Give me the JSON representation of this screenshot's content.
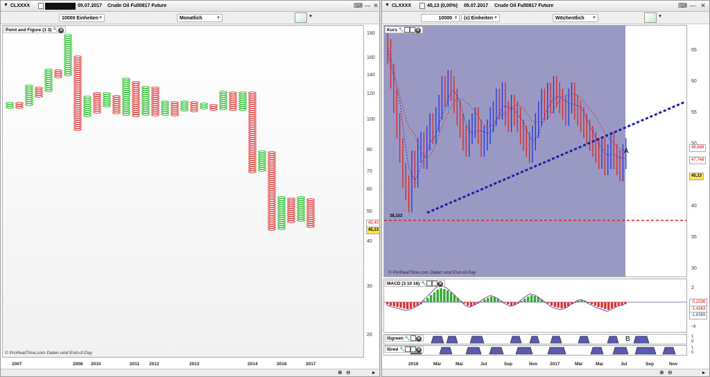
{
  "left": {
    "header": {
      "symbol": "CLXXXX",
      "redacted": "",
      "date": "05.07.2017",
      "name": "Crude Oil Full0817 Future"
    },
    "units_label": "10000 Einheiten",
    "period_label": "Monatlich",
    "panel_title": "Point and Figure (1 3)",
    "price_axis": [
      "190",
      "160",
      "140",
      "120",
      "100",
      "80",
      "70",
      "60",
      "50",
      "40",
      "30",
      "20"
    ],
    "price_tags": {
      "last1": "45,40",
      "last2": "45,13"
    },
    "watermark": "© ProRealTime.com  Daten sind End-of-Day",
    "x_labels": [
      "2007",
      "2008",
      "2010",
      "2011",
      "2012",
      "2013",
      "2014",
      "2016",
      "2017"
    ],
    "colors": {
      "x": "#22bb22",
      "o": "#dd3333"
    }
  },
  "right": {
    "header": {
      "symbol": "CLXXXX",
      "change": "45,13 (0,00%)",
      "date": "05.07.2017",
      "name": "Crude Oil Full0817 Future"
    },
    "units_value": "10000",
    "units_label": "(x) Einheiten",
    "period_label": "Wöchentlich",
    "panel_title": "Kurs",
    "price_axis": [
      "65",
      "60",
      "55",
      "50",
      "45",
      "40",
      "35",
      "30"
    ],
    "price_tags": {
      "p1": "49,648",
      "p2": "47,748",
      "p3": "45,13"
    },
    "support_label": "38,153",
    "point_labels": {
      "a": "A",
      "b": "B"
    },
    "watermark": "© ProRealTime.com  Daten sind End-of-Day",
    "macd": {
      "title": "MACD (3 10 16)",
      "axis": [
        "2",
        "0",
        "-2",
        "-4"
      ],
      "tags": [
        "-0,2036",
        "-1,4363",
        "-1,6389"
      ]
    },
    "isgreen": {
      "title": "ISgreen",
      "axis": [
        "1",
        "0"
      ]
    },
    "isred": {
      "title": "ISred",
      "axis": [
        "1",
        "0"
      ]
    },
    "x_labels": [
      "2016",
      "Mär",
      "Mai",
      "Jul",
      "Sep",
      "Nov",
      "2017",
      "Mär",
      "Mai",
      "Jul",
      "Sep",
      "Nov"
    ],
    "colors": {
      "up": "#2233dd",
      "down": "#dd2222",
      "bg": "#9999c4"
    }
  }
}
